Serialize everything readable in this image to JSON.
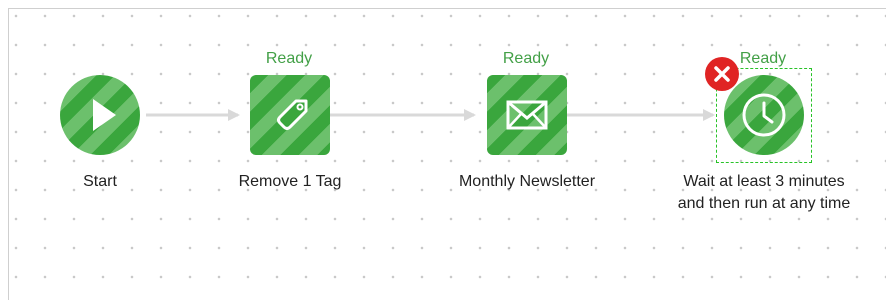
{
  "workflow": {
    "steps": [
      {
        "label": "Start",
        "status": "",
        "icon": "play-icon",
        "shape": "circle"
      },
      {
        "label": "Remove 1 Tag",
        "status": "Ready",
        "icon": "tag-icon",
        "shape": "square"
      },
      {
        "label": "Monthly Newsletter",
        "status": "Ready",
        "icon": "envelope-icon",
        "shape": "square"
      },
      {
        "label_line1": "Wait at least 3 minutes",
        "label_line2": "and then run at any time",
        "status": "Ready",
        "icon": "clock-icon",
        "shape": "circle",
        "selected": true
      }
    ]
  },
  "colors": {
    "node_dark": "#3aa63d",
    "node_light": "#6cc06c",
    "status_text": "#43a047",
    "connector": "#d9d9d9",
    "delete": "#e02424",
    "selection": "#27c327"
  },
  "icons": {
    "delete": "close-icon"
  }
}
